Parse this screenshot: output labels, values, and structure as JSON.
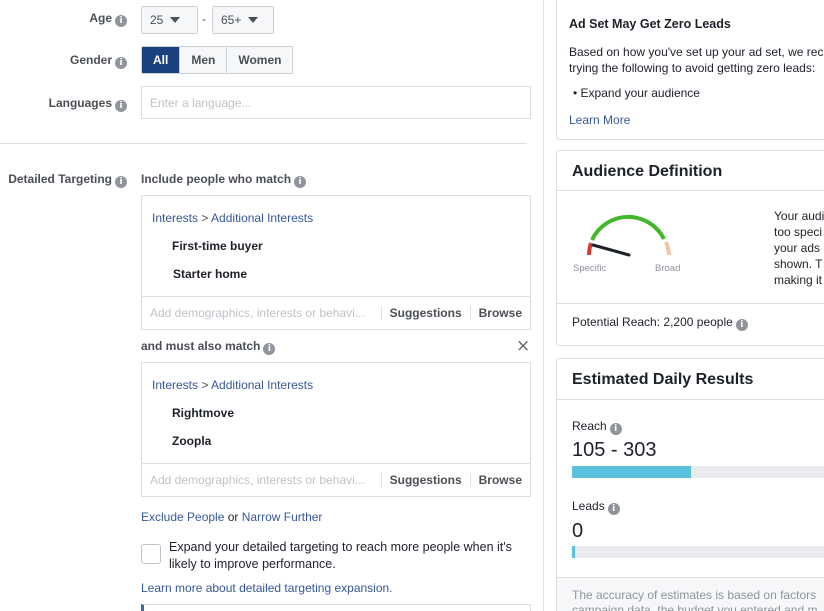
{
  "left": {
    "age": {
      "label": "Age",
      "min": "25",
      "max": "65+",
      "sep": "-"
    },
    "gender": {
      "label": "Gender",
      "options": [
        "All",
        "Men",
        "Women"
      ],
      "selected": "All"
    },
    "languages": {
      "label": "Languages",
      "placeholder": "Enter a language..."
    },
    "detailed": {
      "label": "Detailed Targeting",
      "include_title": "Include people who match",
      "box1": {
        "crumb_a": "Interests",
        "crumb_sep": " > ",
        "crumb_b": "Additional Interests",
        "items": [
          "First-time buyer",
          "Starter home"
        ],
        "placeholder": "Add demographics, interests or behavi...",
        "suggestions": "Suggestions",
        "browse": "Browse"
      },
      "must_title": "and must also match",
      "box2": {
        "crumb_a": "Interests",
        "crumb_sep": " > ",
        "crumb_b": "Additional Interests",
        "items": [
          "Rightmove",
          "Zoopla"
        ],
        "placeholder": "Add demographics, interests or behavi...",
        "suggestions": "Suggestions",
        "browse": "Browse"
      },
      "exclude": "Exclude People",
      "or": " or ",
      "narrow": "Narrow Further",
      "expand_text": "Expand your detailed targeting to reach more people when it's likely to improve performance.",
      "learn_more": "Learn more about detailed targeting expansion."
    }
  },
  "right": {
    "warning": {
      "title": "Ad Set May Get Zero Leads",
      "body": "Based on how you've set up your ad set, we rec trying the following to avoid getting zero leads:",
      "bullet": "Expand your audience",
      "link": "Learn More"
    },
    "audience": {
      "title": "Audience Definition",
      "specific": "Specific",
      "broad": "Broad",
      "text": "Your audi too speci your ads shown. T making it",
      "reach_label": "Potential Reach:",
      "reach_value": "2,200 people"
    },
    "daily": {
      "title": "Estimated Daily Results",
      "reach_label": "Reach",
      "reach_value": "105 - 303",
      "reach_fill": 0.44,
      "leads_label": "Leads",
      "leads_value": "0",
      "leads_fill": 0.01,
      "footer": "The accuracy of estimates is based on factors campaign data, the budget you entered and m"
    }
  },
  "colors": {
    "accent": "#4267b2",
    "bar": "#5bc0de",
    "selected": "#19417f"
  }
}
